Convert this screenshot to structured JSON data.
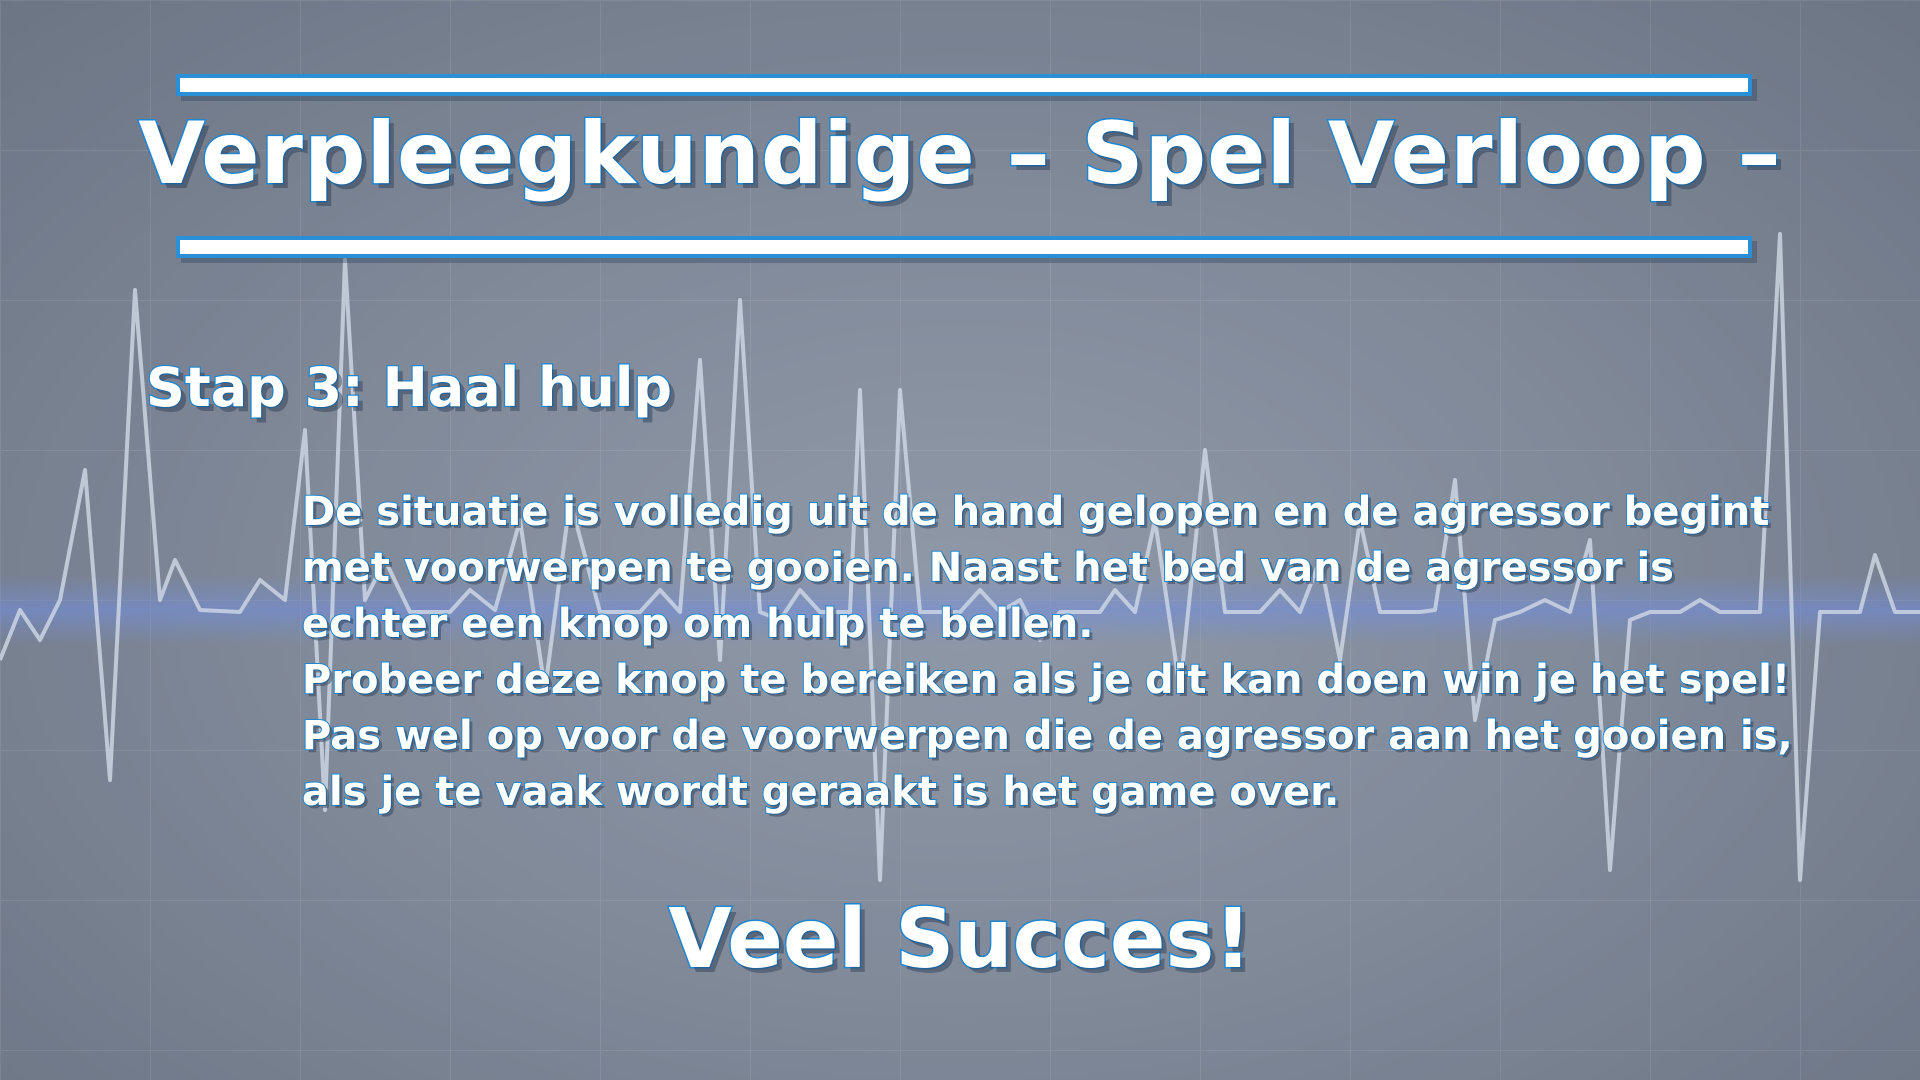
{
  "header": {
    "title": "Verpleegkundige – Spel Verloop –"
  },
  "step": {
    "heading": "Stap 3: Haal hulp"
  },
  "description": {
    "lines": [
      "De situatie is volledig uit de hand gelopen en de agressor begint",
      "met voorwerpen te gooien. Naast het bed van de agressor is",
      "echter een knop om hulp te bellen.",
      "Probeer deze knop te bereiken als je dit kan doen win je het spel!",
      "Pas wel op voor de voorwerpen die de agressor aan het gooien is,",
      "als je te vaak wordt geraakt is het game over."
    ]
  },
  "footer": {
    "closing": "Veel Succes!"
  },
  "colors": {
    "accent": "#1f86d0",
    "text": "#ffffff",
    "background": "#8a93a2",
    "ecg_line": "#dfe9f5"
  },
  "decor": {
    "background_icon": "heartbeat-ecg-icon"
  }
}
